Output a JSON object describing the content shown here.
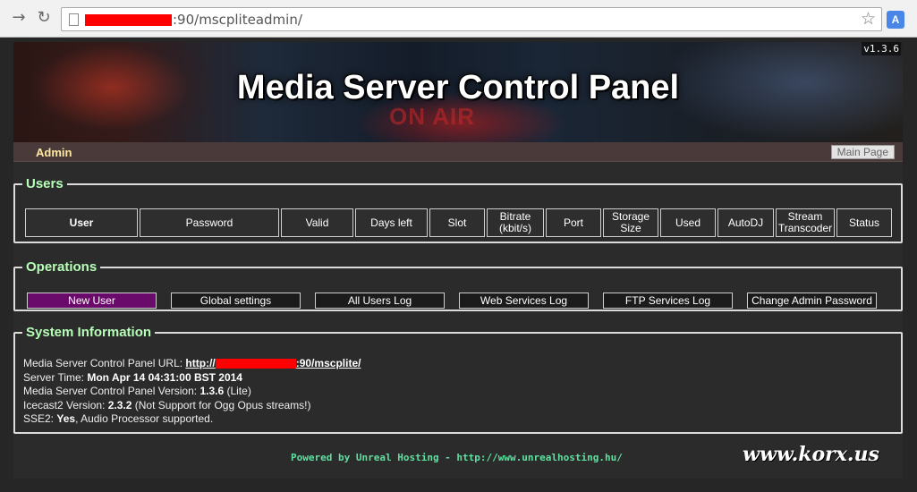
{
  "browser": {
    "url_suffix": ":90/mscpliteadmin/",
    "back_icon": "arrow-right-icon",
    "reload_icon": "reload-icon",
    "star_icon": "star-icon",
    "translate_icon": "translate-icon",
    "translate_glyph": "A"
  },
  "banner": {
    "title": "Media Server Control Panel",
    "version": "v1.3.6",
    "onair": "ON AIR"
  },
  "admin_bar": {
    "label": "Admin",
    "main_page_button": "Main Page"
  },
  "users": {
    "legend": "Users",
    "columns": [
      "User",
      "Password",
      "Valid",
      "Days left",
      "Slot",
      "Bitrate (kbit/s)",
      "Port",
      "Storage Size",
      "Used",
      "AutoDJ",
      "Stream Transcoder",
      "Status"
    ]
  },
  "operations": {
    "legend": "Operations",
    "buttons": [
      "New User",
      "Global settings",
      "All Users Log",
      "Web Services Log",
      "FTP Services Log",
      "Change Admin Password"
    ]
  },
  "system_information": {
    "legend": "System Information",
    "url_label": "Media Server Control Panel URL: ",
    "url_prefix": "http://",
    "url_suffix": ":90/mscplite/",
    "server_time_label": "Server Time: ",
    "server_time_value": "Mon Apr 14 04:31:00 BST 2014",
    "version_label": "Media Server Control Panel Version: ",
    "version_value": "1.3.6",
    "version_edition": " (Lite)",
    "icecast_label": "Icecast2 Version: ",
    "icecast_value": "2.3.2",
    "icecast_note": " (Not Support for Ogg Opus streams!)",
    "sse_label": "SSE2: ",
    "sse_value": "Yes",
    "sse_note": ", Audio Processor supported."
  },
  "footer": {
    "powered_by": "Powered by Unreal Hosting - http://www.unrealhosting.hu/",
    "watermark": "www.korx.us"
  }
}
